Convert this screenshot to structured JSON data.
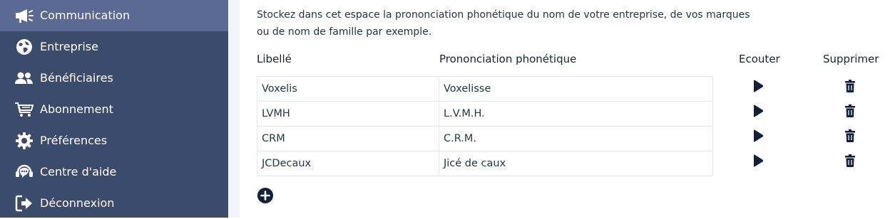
{
  "sidebar": {
    "items": [
      {
        "label": "Communication",
        "icon": "megaphone-icon",
        "active": true
      },
      {
        "label": "Entreprise",
        "icon": "globe-icon"
      },
      {
        "label": "Bénéficiaires",
        "icon": "users-icon"
      },
      {
        "label": "Abonnement",
        "icon": "cart-icon"
      },
      {
        "label": "Préférences",
        "icon": "gear-icon"
      },
      {
        "label": "Centre d'aide",
        "icon": "headset-icon"
      },
      {
        "label": "Déconnexion",
        "icon": "logout-icon"
      }
    ]
  },
  "main": {
    "description_line1": "Stockez dans cet espace la prononciation phonétique du nom de votre entreprise, de vos marques",
    "description_line2": "ou de nom de famille par exemple.",
    "columns": {
      "label": "Libellé",
      "phonetic": "Prononciation phonétique",
      "listen": "Ecouter",
      "delete": "Supprimer"
    },
    "rows": [
      {
        "label": "Voxelis",
        "phonetic": "Voxelisse"
      },
      {
        "label": "LVMH",
        "phonetic": "L.V.M.H."
      },
      {
        "label": "CRM",
        "phonetic": "C.R.M."
      },
      {
        "label": "JCDecaux",
        "phonetic": "Jicé de caux"
      }
    ]
  },
  "colors": {
    "sidebar_bg": "#3b4b6c",
    "sidebar_active": "#5a6a94",
    "icon_dark": "#13203a"
  }
}
